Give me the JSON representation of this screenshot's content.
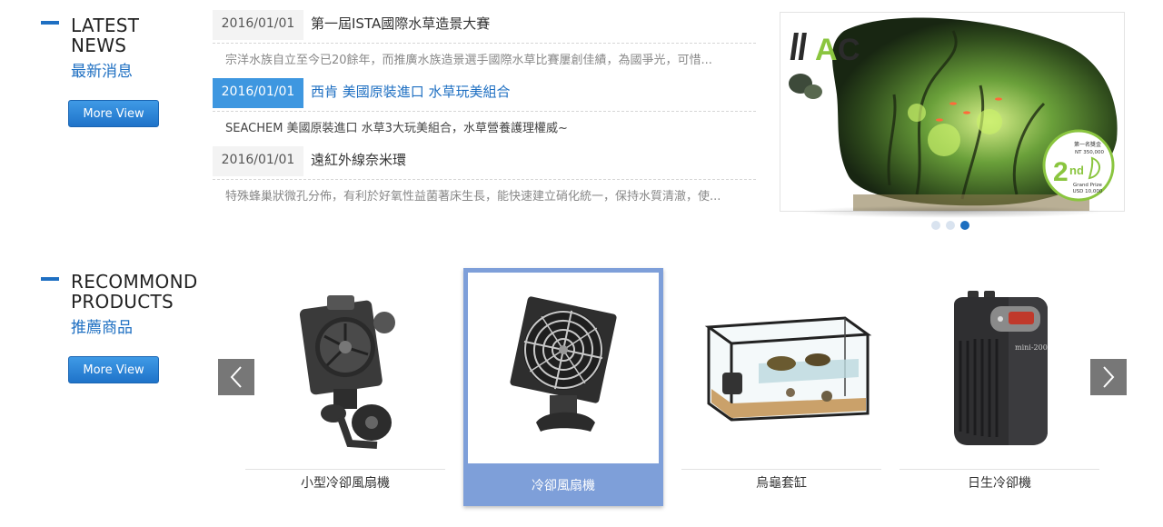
{
  "latest_news": {
    "title_en_line1": "LATEST",
    "title_en_line2": "NEWS",
    "title_zh": "最新消息",
    "more_label": "More View",
    "items": [
      {
        "date": "2016/01/01",
        "title": "第一屆ISTA國際水草造景大賽",
        "desc": "宗洋水族自立至今已20餘年，而推廣水族造景選手國際水草比賽屢創佳績，為國爭光，可惜..."
      },
      {
        "date": "2016/01/01",
        "title": "西肯 美國原裝進口 水草玩美組合",
        "desc": "SEACHEM 美國原裝進口 水草3大玩美組合，水草營養護理權威~"
      },
      {
        "date": "2016/01/01",
        "title": "遠紅外線奈米環",
        "desc": "特殊蜂巢狀微孔分佈，有利於好氧性益菌著床生長，能快速建立硝化統一，保持水質清澈，使..."
      }
    ],
    "active_index": 1
  },
  "banner": {
    "logo_text": "IIAC",
    "badge": {
      "line_top": "第一名獎金",
      "line_amount": "NT 350,000",
      "rank_num": "2",
      "rank_suffix": "nd",
      "line_grand": "Grand Prize",
      "line_usd": "USD 10,000"
    },
    "slide_count": 3,
    "active_slide": 3
  },
  "recommend": {
    "title_en_line1": "RECOMMOND",
    "title_en_line2": "PRODUCTS",
    "title_zh": "推薦商品",
    "more_label": "More View",
    "prev_icon": "chevron-left-icon",
    "next_icon": "chevron-right-icon",
    "products": [
      {
        "name": "小型冷卻風扇機",
        "image": "clip-fan-icon"
      },
      {
        "name": "冷卻風扇機",
        "image": "fan-icon"
      },
      {
        "name": "烏龜套缸",
        "image": "turtle-tank-icon"
      },
      {
        "name": "日生冷卻機",
        "image": "chiller-icon"
      }
    ],
    "selected_index": 1,
    "chiller_label": "mini-200"
  },
  "colors": {
    "accent": "#1e6fc2",
    "active_date_bg": "#3e97e0",
    "selected_card": "#7e9fd9",
    "arrow_bg": "#777777"
  }
}
